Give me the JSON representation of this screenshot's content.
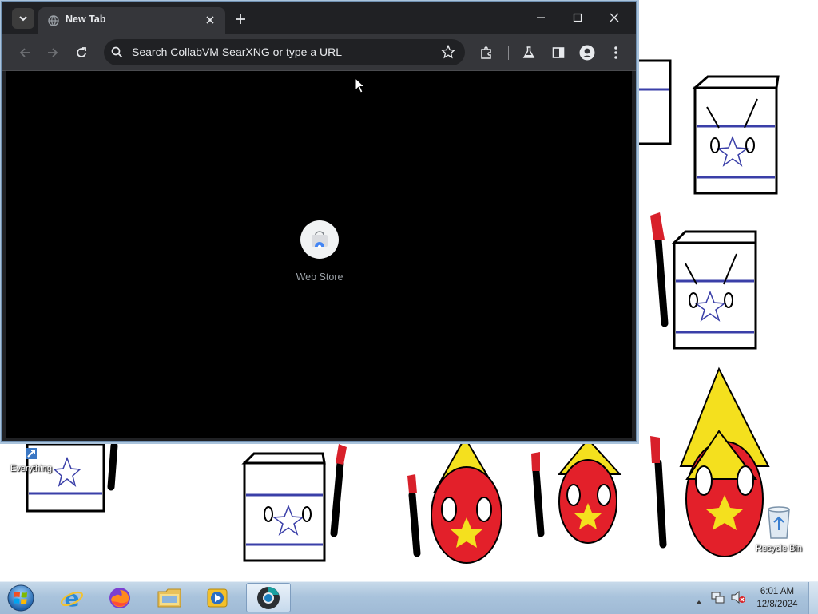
{
  "browser": {
    "tab_title": "New Tab",
    "omnibox_placeholder": "Search CollabVM SearXNG or type a URL",
    "shortcut_label": "Web Store",
    "icons": {
      "tab_search": "chevron-down-icon",
      "tab_favicon": "globe-icon",
      "tab_close": "close-icon",
      "new_tab": "plus-icon",
      "minimize": "minimize-icon",
      "maximize": "maximize-icon",
      "close": "close-icon",
      "back": "back-arrow-icon",
      "forward": "forward-arrow-icon",
      "reload": "reload-icon",
      "search": "search-icon",
      "bookmark": "star-icon",
      "extensions": "puzzle-icon",
      "labs": "flask-icon",
      "side_panel": "side-panel-icon",
      "profile": "profile-icon",
      "menu": "kebab-menu-icon"
    },
    "colors": {
      "frame": "#202124",
      "toolbar": "#35363a",
      "content": "#000000",
      "text": "#e8eaed"
    }
  },
  "desktop": {
    "icons": [
      {
        "label": "Everything"
      },
      {
        "label": "Recycle Bin"
      }
    ]
  },
  "taskbar": {
    "apps": [
      "start-orb",
      "internet-explorer-icon",
      "firefox-icon",
      "file-explorer-icon",
      "media-player-icon",
      "chrome-icon"
    ],
    "clock_time": "6:01 AM",
    "clock_date": "12/8/2024"
  }
}
